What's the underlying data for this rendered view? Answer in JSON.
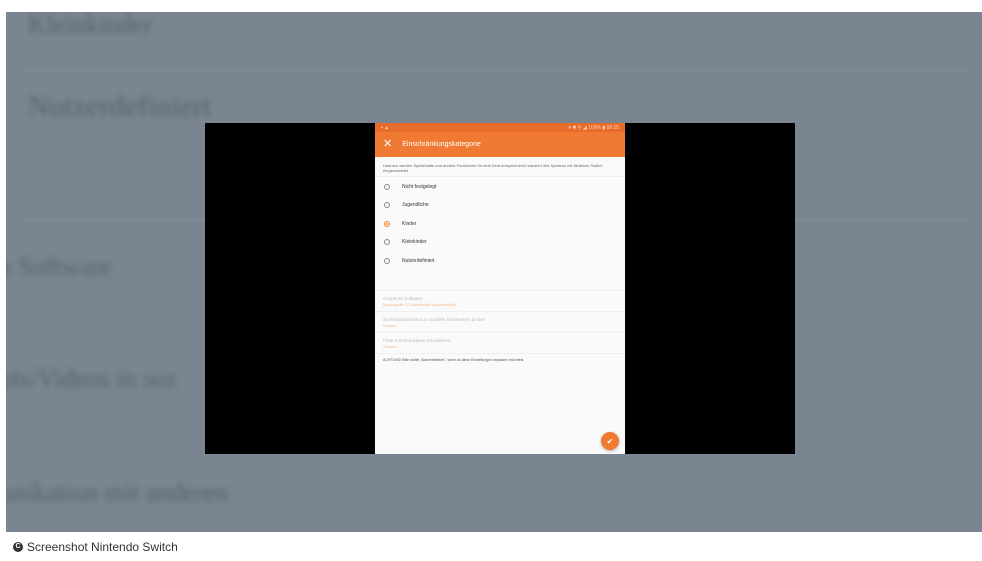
{
  "colors": {
    "accent": "#f07a33",
    "backdrop": "#7b8591",
    "player": "#000000"
  },
  "background": {
    "texts": [
      "Kleinkinder",
      "Nutzerdefiniert",
      "e Software",
      "ots/Videos in soz",
      "unikation mit anderen"
    ]
  },
  "phone": {
    "statusbar": {
      "left": "▪ ▲",
      "right": "▾ ✱ ⚲ ◢ 100% ▮ 09:15"
    },
    "appbar": {
      "close_icon": "close-icon",
      "title": "Einschränkungskategorie"
    },
    "description": "Dadurch werden Spielinhalte und andere Funktionen für dein Kind entsprechend reduziert des Spielens mit Nintendo Switch eingeschränkt.",
    "options": [
      {
        "label": "Nicht festgelegt",
        "selected": false
      },
      {
        "label": "Jugendliche",
        "selected": false
      },
      {
        "label": "Kinder",
        "selected": true
      },
      {
        "label": "Kleinkinder",
        "selected": false
      },
      {
        "label": "Nutzerdefiniert",
        "selected": false
      }
    ],
    "settings": [
      {
        "title": "Gesperrte Software",
        "subtitle": "Nutzungsalter 12 (vorbehaltlich Ausnahmefälle)"
      },
      {
        "title": "Screenshots/Videos in sozialen Netzwerken posten",
        "subtitle": "Gesperrt"
      },
      {
        "title": "Freie Kommunikation mit anderen",
        "subtitle": "Gesperrt"
      }
    ],
    "note": "ACHTUNG! Bitte wähle „Nutzerdefiniert\", wenn du diese Einstellungen anpassen möchtest.",
    "fab_icon": "check-icon"
  },
  "credit": {
    "icon": "copyright-icon",
    "text": "Screenshot Nintendo Switch"
  }
}
